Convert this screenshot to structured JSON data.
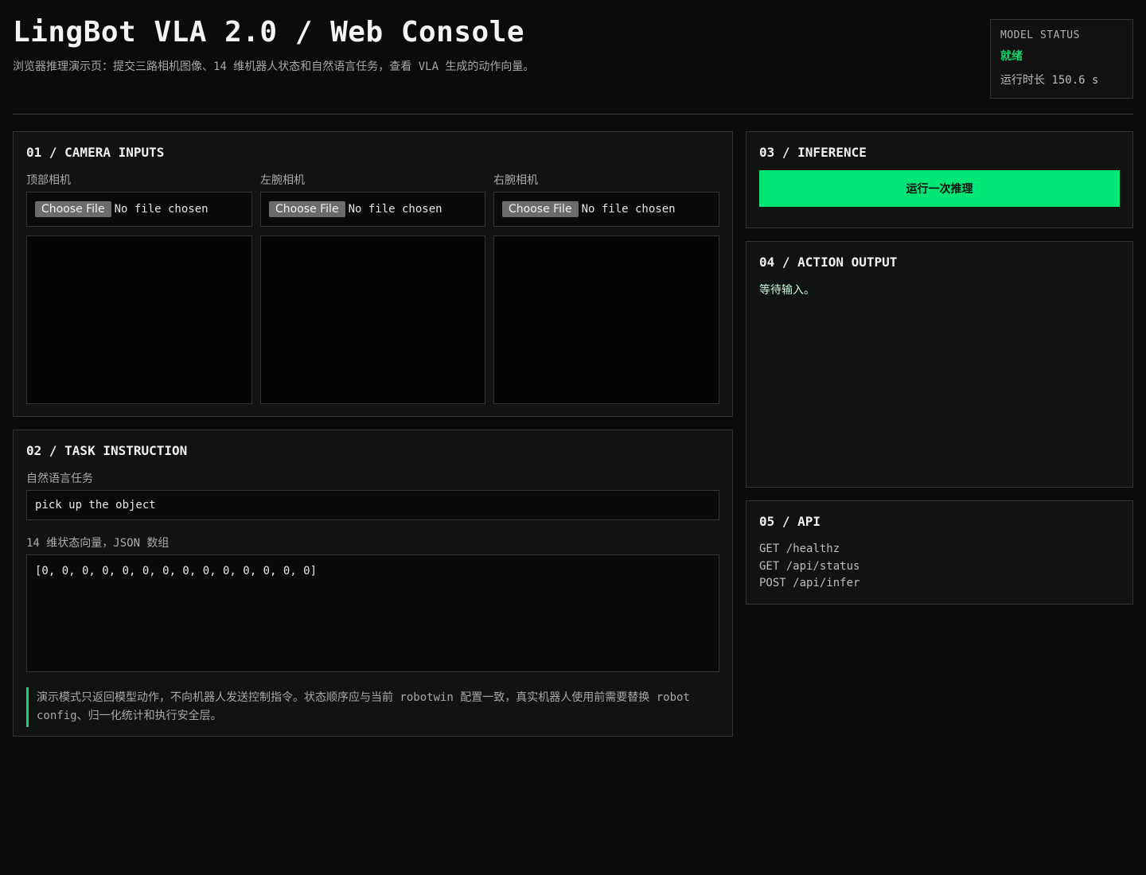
{
  "header": {
    "title": "LingBot VLA 2.0 / Web Console",
    "subtitle": "浏览器推理演示页：提交三路相机图像、14 维机器人状态和自然语言任务，查看 VLA 生成的动作向量。"
  },
  "status": {
    "label": "MODEL STATUS",
    "value": "就绪",
    "uptime": "运行时长 150.6 s"
  },
  "colors": {
    "accent": "#00e676",
    "background": "#0b0b0a",
    "panel": "#111312"
  },
  "camera": {
    "title": "01 / CAMERA INPUTS",
    "inputs": [
      {
        "label": "顶部相机",
        "button": "Choose File",
        "file": "No file chosen"
      },
      {
        "label": "左腕相机",
        "button": "Choose File",
        "file": "No file chosen"
      },
      {
        "label": "右腕相机",
        "button": "Choose File",
        "file": "No file chosen"
      }
    ]
  },
  "task": {
    "title": "02 / TASK INSTRUCTION",
    "instruction_label": "自然语言任务",
    "instruction_value": "pick up the object",
    "state_label": "14 维状态向量，JSON 数组",
    "state_value": "[0, 0, 0, 0, 0, 0, 0, 0, 0, 0, 0, 0, 0, 0]",
    "note_line1": "演示模式只返回模型动作，不向机器人发送控制指令。状态顺序应与当前 robotwin 配置一致，真实机器人使用前需要替换 robot",
    "note_line2": "config、归一化统计和执行安全层。"
  },
  "inference": {
    "title": "03 / INFERENCE",
    "button": "运行一次推理"
  },
  "action": {
    "title": "04 / ACTION OUTPUT",
    "text": "等待输入。"
  },
  "api": {
    "title": "05 / API",
    "endpoints": [
      "GET /healthz",
      "GET /api/status",
      "POST /api/infer"
    ]
  }
}
